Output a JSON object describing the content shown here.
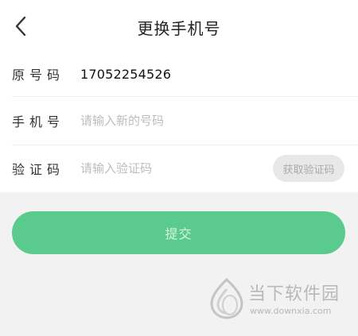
{
  "header": {
    "title": "更换手机号",
    "back_icon": "chevron-left-icon"
  },
  "form": {
    "original_number": {
      "label": "原号码",
      "value": "17052254526"
    },
    "new_phone": {
      "label": "手机号",
      "placeholder": "请输入新的号码",
      "value": ""
    },
    "verification": {
      "label": "验证码",
      "placeholder": "请输入验证码",
      "value": "",
      "button_label": "获取验证码"
    }
  },
  "submit": {
    "label": "提交"
  },
  "watermark": {
    "brand": "当下软件园",
    "url": "www.downxia.com"
  },
  "colors": {
    "accent": "#5acb8c",
    "background": "#f2f2f2",
    "placeholder": "#bdbdbd"
  }
}
